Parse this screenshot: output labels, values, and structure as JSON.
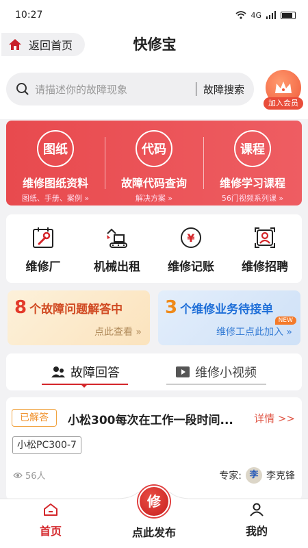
{
  "status_bar": {
    "time": "10:27",
    "network": "4G"
  },
  "header": {
    "back_label": "返回首页",
    "title": "快修宝"
  },
  "search": {
    "placeholder": "请描述你的故障现象",
    "button_label": "故障搜索"
  },
  "vip": {
    "label": "加入会员"
  },
  "banner": {
    "items": [
      {
        "icon_text": "图纸",
        "title": "维修图纸资料",
        "subtitle": "图纸、手册、案例 »"
      },
      {
        "icon_text": "代码",
        "title": "故障代码查询",
        "subtitle": "解决方案 »"
      },
      {
        "icon_text": "课程",
        "title": "维修学习课程",
        "subtitle": "56门视频系列课 »"
      }
    ]
  },
  "quick": {
    "items": [
      {
        "label": "维修厂",
        "icon": "wrench-calendar-icon"
      },
      {
        "label": "机械出租",
        "icon": "excavator-icon"
      },
      {
        "label": "维修记账",
        "icon": "yuan-coin-icon"
      },
      {
        "label": "维修招聘",
        "icon": "recruit-person-icon"
      }
    ]
  },
  "promo": {
    "left": {
      "count": "8",
      "text": "个故障问题解答中",
      "link": "点此查看 »"
    },
    "right": {
      "count": "3",
      "text": "个维修业务待接单",
      "link": "维修工点此加入 »",
      "badge": "NEW"
    }
  },
  "tabs": [
    {
      "label": "故障回答",
      "active": true
    },
    {
      "label": "维修小视频",
      "active": false
    }
  ],
  "qa": {
    "status": "已解答",
    "title": "小松300每次在工作一段时间...",
    "detail_link": "详情 >>",
    "model": "小松PC300-7",
    "views": "56人",
    "expert_label": "专家:",
    "expert_avatar": "李",
    "expert_name": "李克锋"
  },
  "bottom_nav": {
    "home": "首页",
    "publish_icon": "修",
    "publish": "点此发布",
    "mine": "我的"
  },
  "colors": {
    "brand_red": "#d4262a",
    "banner_red": "#e84a4e",
    "answered_orange": "#f0902a"
  }
}
